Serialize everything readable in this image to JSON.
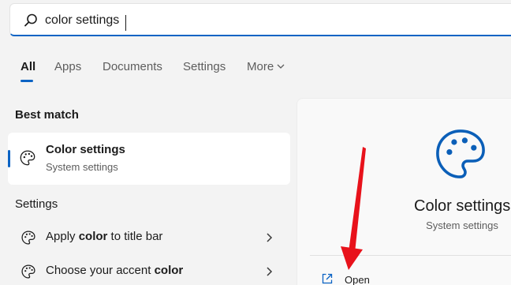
{
  "search": {
    "query": "color settings"
  },
  "tabs": [
    {
      "label": "All"
    },
    {
      "label": "Apps"
    },
    {
      "label": "Documents"
    },
    {
      "label": "Settings"
    },
    {
      "label": "More"
    }
  ],
  "best_match": {
    "heading": "Best match",
    "title": "Color settings",
    "subtitle": "System settings"
  },
  "settings_section": {
    "heading": "Settings",
    "items": [
      {
        "prefix": "Apply ",
        "bold": "color",
        "suffix": " to title bar"
      },
      {
        "prefix": "Choose your accent ",
        "bold": "color",
        "suffix": ""
      }
    ]
  },
  "detail": {
    "title": "Color settings",
    "subtitle": "System settings",
    "action_open": "Open"
  },
  "colors": {
    "accent": "#0b63c4",
    "annotation_arrow": "#e8121b",
    "palette_icon_detail": "#0b5fb8"
  },
  "icons": [
    "search-icon",
    "palette-icon",
    "chevron-right-icon",
    "chevron-down-icon",
    "open-external-icon"
  ]
}
